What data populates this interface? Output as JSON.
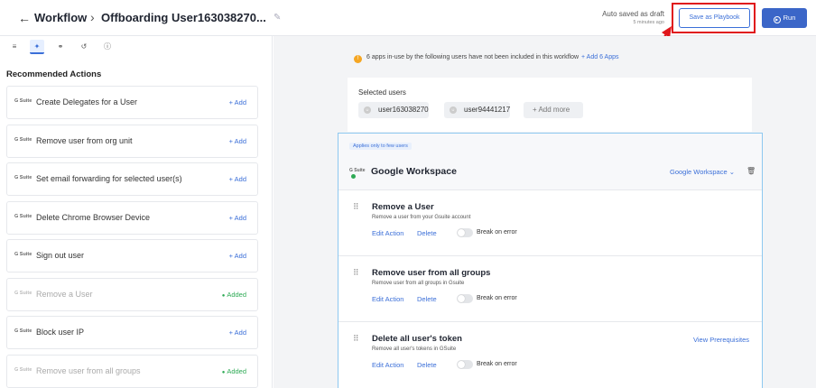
{
  "header": {
    "breadcrumb_root": "Workflow",
    "title": "Offboarding User163038270...",
    "autosave_status": "Auto saved as draft",
    "autosave_time": "5 minutes ago",
    "playbook_label": "Save as Playbook",
    "run_label": "Run"
  },
  "colors": {
    "accent": "#3b6fd8",
    "run": "#3b66c8",
    "annotation": "#e0161b",
    "added": "#2eaa55",
    "warning": "#f5a623"
  },
  "toolbar": {
    "icons": [
      "list-icon",
      "sparkle-icon",
      "link-icon",
      "history-icon",
      "help-icon"
    ]
  },
  "left": {
    "section_title": "Recommended Actions",
    "app_tag": "G Suite",
    "add_label": "+ Add",
    "added_label": "Added",
    "actions": [
      {
        "label": "Create Delegates for a User",
        "status": "add"
      },
      {
        "label": "Remove user from org unit",
        "status": "add"
      },
      {
        "label": "Set email forwarding for selected user(s)",
        "status": "add"
      },
      {
        "label": "Delete Chrome Browser Device",
        "status": "add"
      },
      {
        "label": "Sign out user",
        "status": "add"
      },
      {
        "label": "Remove a User",
        "status": "added"
      },
      {
        "label": "Block user IP",
        "status": "add"
      },
      {
        "label": "Remove user from all groups",
        "status": "added"
      }
    ]
  },
  "notice": {
    "text": "6 apps in-use by the following users have not been included in this workflow",
    "link": "+ Add 6 Apps"
  },
  "users": {
    "title": "Selected users",
    "chips": [
      "user163038270",
      "user94441217"
    ],
    "add_more": "+ Add more"
  },
  "workspace": {
    "applies": "Applies only to few users",
    "logo_text": "G Suite",
    "name": "Google Workspace",
    "select_label": "Google Workspace",
    "edit_label": "Edit Action",
    "delete_label": "Delete",
    "break_label": "Break on error",
    "steps": [
      {
        "name": "Remove a User",
        "desc": "Remove a user from your Gsuite account",
        "prereq": "",
        "break_on_error": false
      },
      {
        "name": "Remove user from all groups",
        "desc": "Remove user from all groups in Gsuite",
        "prereq": "",
        "break_on_error": false
      },
      {
        "name": "Delete all user's token",
        "desc": "Remove all user's tokens in GSuite",
        "prereq": "View Prerequisites",
        "break_on_error": false
      }
    ]
  }
}
